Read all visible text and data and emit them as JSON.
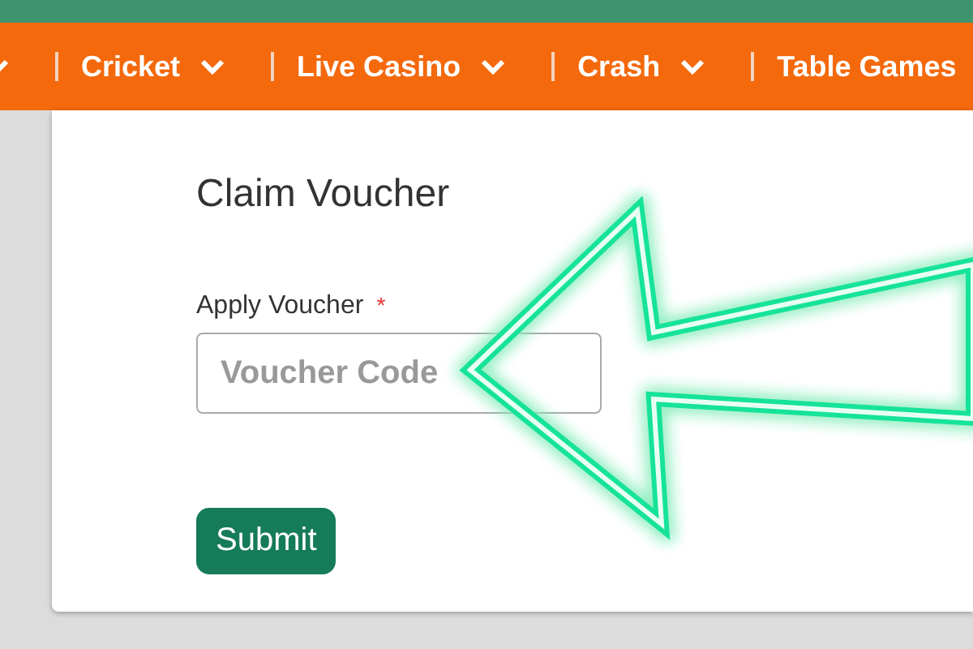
{
  "nav": {
    "items": [
      {
        "kind": "chevron"
      },
      {
        "kind": "dropdown",
        "label": "Cricket"
      },
      {
        "kind": "dropdown",
        "label": "Live Casino"
      },
      {
        "kind": "dropdown",
        "label": "Crash"
      },
      {
        "kind": "text",
        "label": "Table Games"
      }
    ]
  },
  "form": {
    "title": "Claim Voucher",
    "field": {
      "label": "Apply Voucher",
      "required_mark": "*",
      "placeholder": "Voucher Code"
    },
    "submit": "Submit"
  }
}
